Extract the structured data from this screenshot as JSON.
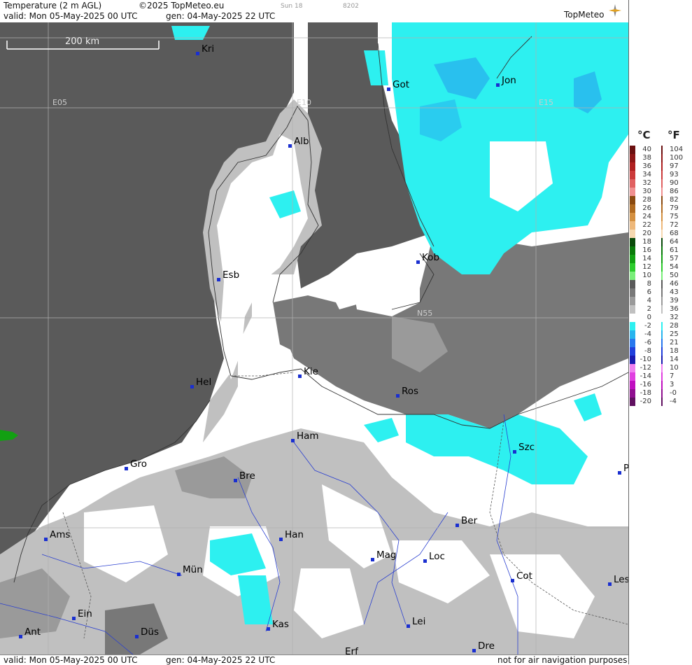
{
  "header": {
    "title": "Temperature (2 m AGL)",
    "copyright": "©2025 TopMeteo.eu",
    "model": "Sun 18",
    "code": "8202",
    "valid": "valid:  Mon  05-May-2025  00 UTC",
    "gen": "gen: 04-May-2025 22 UTC",
    "logo": "TopMeteo"
  },
  "scale": {
    "label": "200 km"
  },
  "grid_labels": [
    "E05",
    "E10",
    "E15",
    "N55"
  ],
  "cities": [
    "Kri",
    "Got",
    "Jon",
    "Alb",
    "Kob",
    "Esb",
    "Kie",
    "Hel",
    "Ros",
    "Ham",
    "Szc",
    "Gro",
    "Bre",
    "P",
    "Ber",
    "Ams",
    "Han",
    "Mag",
    "Loc",
    "Mün",
    "Cot",
    "Les",
    "Ein",
    "Kas",
    "Lei",
    "Ant",
    "Düs",
    "Dre",
    "Erf"
  ],
  "legend": {
    "celsius_unit": "°C",
    "fahrenheit_unit": "°F",
    "entries": [
      {
        "c": "40",
        "f": "104",
        "color": "#6b1010"
      },
      {
        "c": "38",
        "f": "100",
        "color": "#8e1616"
      },
      {
        "c": "36",
        "f": "97",
        "color": "#b02020"
      },
      {
        "c": "34",
        "f": "93",
        "color": "#cc3a3a"
      },
      {
        "c": "32",
        "f": "90",
        "color": "#e06060"
      },
      {
        "c": "30",
        "f": "86",
        "color": "#f09090"
      },
      {
        "c": "28",
        "f": "82",
        "color": "#8a4a10"
      },
      {
        "c": "26",
        "f": "79",
        "color": "#b06a20"
      },
      {
        "c": "24",
        "f": "75",
        "color": "#d49040"
      },
      {
        "c": "22",
        "f": "72",
        "color": "#eeb87a"
      },
      {
        "c": "20",
        "f": "68",
        "color": "#f6d8b0"
      },
      {
        "c": "18",
        "f": "64",
        "color": "#0a4a0a"
      },
      {
        "c": "16",
        "f": "61",
        "color": "#0a7a0a"
      },
      {
        "c": "14",
        "f": "57",
        "color": "#12a012"
      },
      {
        "c": "12",
        "f": "54",
        "color": "#2ccc2c"
      },
      {
        "c": "10",
        "f": "50",
        "color": "#7aee7a"
      },
      {
        "c": "8",
        "f": "46",
        "color": "#5a5a5a"
      },
      {
        "c": "6",
        "f": "43",
        "color": "#787878"
      },
      {
        "c": "4",
        "f": "39",
        "color": "#9a9a9a"
      },
      {
        "c": "2",
        "f": "36",
        "color": "#c0c0c0"
      },
      {
        "c": "0",
        "f": "32",
        "color": "#ffffff"
      },
      {
        "c": "-2",
        "f": "28",
        "color": "#2df0f0"
      },
      {
        "c": "-4",
        "f": "25",
        "color": "#28b4ee"
      },
      {
        "c": "-6",
        "f": "21",
        "color": "#2878ee"
      },
      {
        "c": "-8",
        "f": "18",
        "color": "#2040dc"
      },
      {
        "c": "-10",
        "f": "14",
        "color": "#1a1ab0"
      },
      {
        "c": "-12",
        "f": "10",
        "color": "#f080f0"
      },
      {
        "c": "-14",
        "f": "7",
        "color": "#e040e0"
      },
      {
        "c": "-16",
        "f": "3",
        "color": "#c010c0"
      },
      {
        "c": "-18",
        "f": "-0",
        "color": "#901090"
      },
      {
        "c": "-20",
        "f": "-4",
        "color": "#601060"
      }
    ]
  },
  "footer": {
    "valid": "valid:  Mon  05-May-2025  00 UTC",
    "gen": "gen: 04-May-2025 22 UTC",
    "note": "not for air navigation purposes"
  }
}
